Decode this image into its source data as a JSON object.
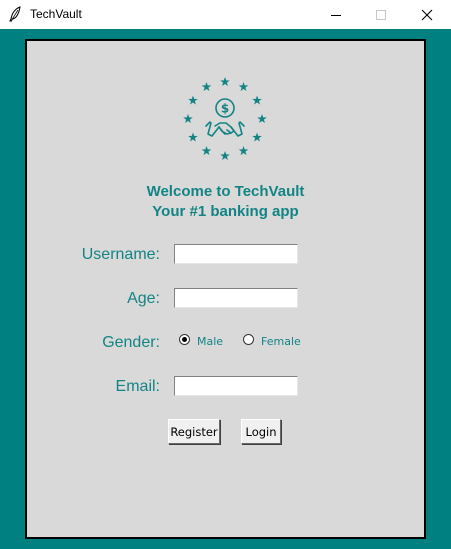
{
  "window": {
    "title": "TechVault",
    "app_icon": "feather-icon",
    "controls": [
      "minimize-icon",
      "maximize-icon",
      "close-icon"
    ]
  },
  "logo": {
    "icon": "handshake-dollar-stars-icon"
  },
  "welcome": {
    "line1": "Welcome to TechVault",
    "line2": "Your #1 banking app"
  },
  "form": {
    "username_label": "Username:",
    "username_value": "",
    "age_label": "Age:",
    "age_value": "",
    "gender_label": "Gender:",
    "gender_options": [
      {
        "label": "Male",
        "selected": true
      },
      {
        "label": "Female",
        "selected": false
      }
    ],
    "email_label": "Email:",
    "email_value": ""
  },
  "buttons": {
    "register": "Register",
    "login": "Login"
  },
  "colors": {
    "background": "#008080",
    "panel": "#d9d9d9",
    "accent_text": "#138484"
  }
}
